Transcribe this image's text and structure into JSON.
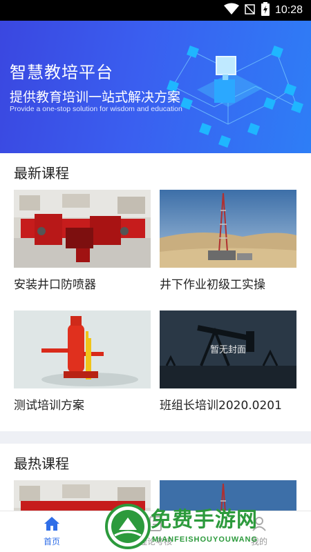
{
  "status_bar": {
    "time": "10:28",
    "icons": [
      "wifi-icon",
      "no-signal-icon",
      "battery-charging-icon"
    ]
  },
  "banner": {
    "title": "智慧教培平台",
    "subtitle": "提供教育培训一站式解决方案",
    "subtitle_en": "Provide a one-stop solution for wisdom and education"
  },
  "latest": {
    "title": "最新课程",
    "courses": [
      {
        "name": "安装井口防喷器",
        "cover": "blowout-preventer-photo"
      },
      {
        "name": "井下作业初级工实操",
        "cover": "drilling-rig-photo"
      },
      {
        "name": "测试培训方案",
        "cover": "red-equipment-3d-photo"
      },
      {
        "name": "班组长培训2020.0201",
        "cover": "no-cover-placeholder",
        "cover_text": "暂无封面"
      }
    ]
  },
  "hot": {
    "title": "最热课程"
  },
  "bottom_nav": {
    "items": [
      {
        "label": "首页",
        "icon": "home-icon",
        "active": true
      },
      {
        "label": "理论考核",
        "icon": "exam-icon",
        "active": false
      },
      {
        "label": "我的",
        "icon": "profile-icon",
        "active": false
      }
    ]
  },
  "watermark": {
    "text": "免费手游网",
    "sub": "MIANFEISHOUYOUWANG"
  },
  "colors": {
    "accent": "#2f6ee8",
    "banner_start": "#3a47e0",
    "banner_end": "#2e7ef6",
    "watermark": "#2c9a3c"
  }
}
